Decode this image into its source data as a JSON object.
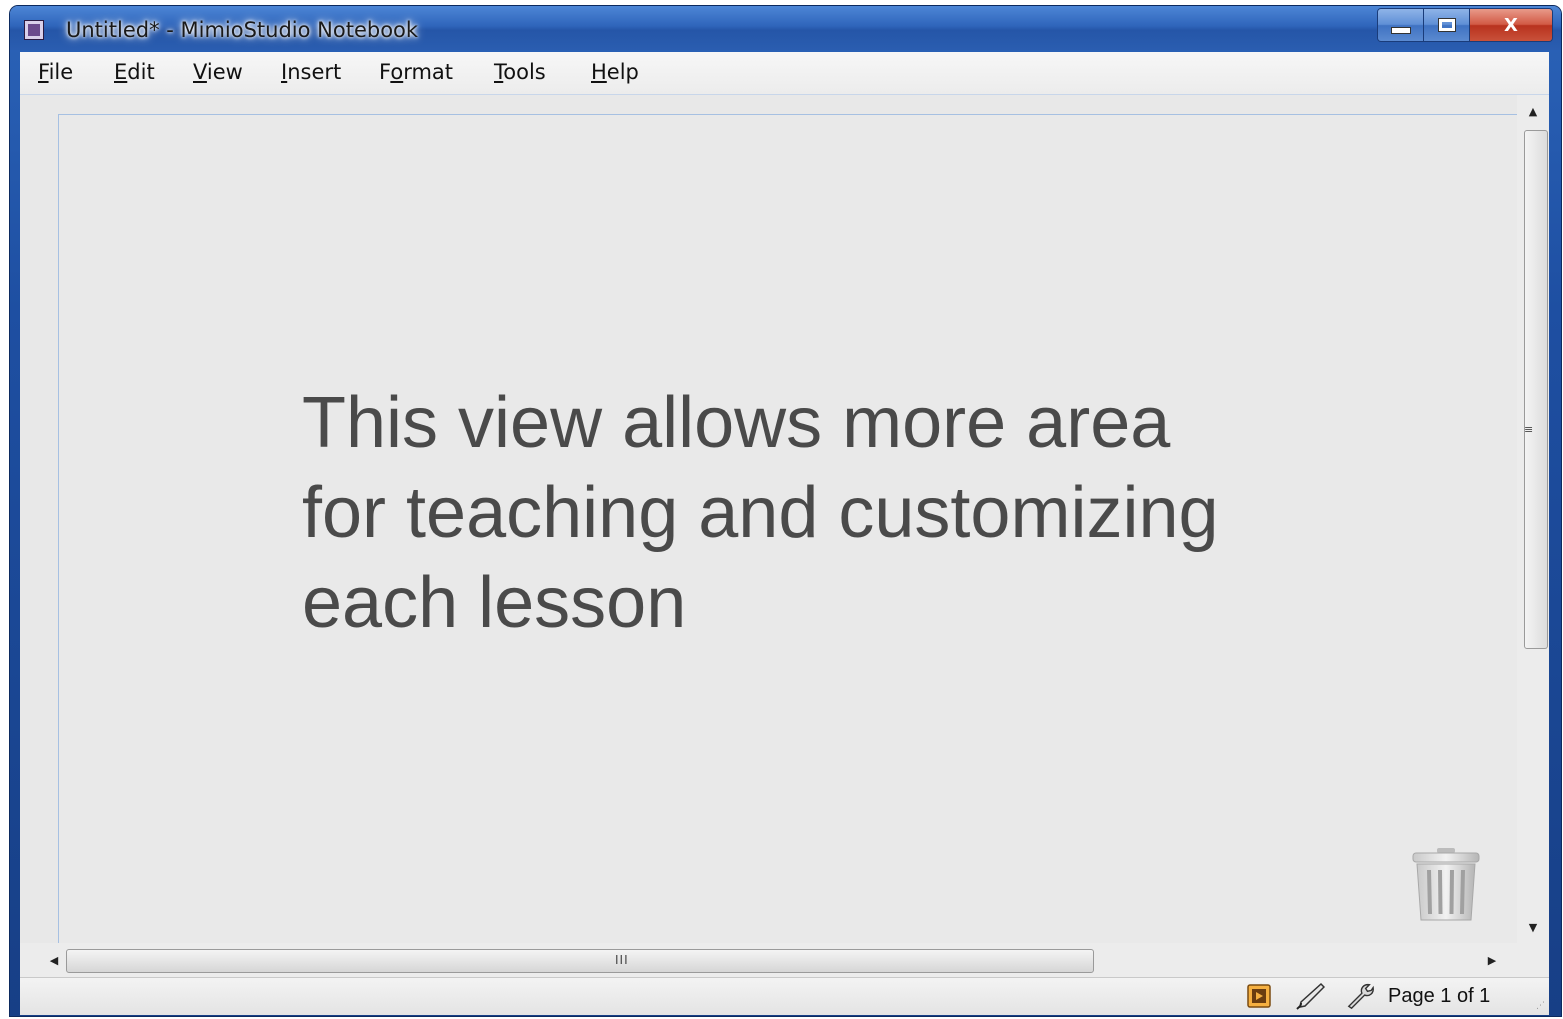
{
  "window": {
    "title": "Untitled* - MimioStudio Notebook",
    "app_icon": "notebook-icon",
    "controls": {
      "minimize": "minimize-icon",
      "maximize": "maximize-icon",
      "close": "X"
    }
  },
  "menubar": {
    "items": [
      {
        "label": "File",
        "accel": "F",
        "rest": "ile"
      },
      {
        "label": "Edit",
        "accel": "E",
        "rest": "dit"
      },
      {
        "label": "View",
        "accel": "V",
        "rest": "iew"
      },
      {
        "label": "Insert",
        "accel": "I",
        "rest": "nsert"
      },
      {
        "label": "Format",
        "pre": "F",
        "accel": "o",
        "rest": "rmat"
      },
      {
        "label": "Tools",
        "accel": "T",
        "rest": "ools"
      },
      {
        "label": "Help",
        "accel": "H",
        "rest": "elp"
      }
    ]
  },
  "canvas": {
    "text": "This view allows more area\nfor teaching and customizing\neach lesson",
    "trash_icon": "trash-icon"
  },
  "scrollbars": {
    "vertical": {
      "up": "▲",
      "down": "▼",
      "grip": "≡"
    },
    "horizontal": {
      "left": "◀",
      "right": "▶",
      "grip": "III"
    }
  },
  "statusbar": {
    "icons": [
      "presentation-icon",
      "pen-icon",
      "wrench-icon"
    ],
    "page_indicator": "Page 1 of 1"
  }
}
